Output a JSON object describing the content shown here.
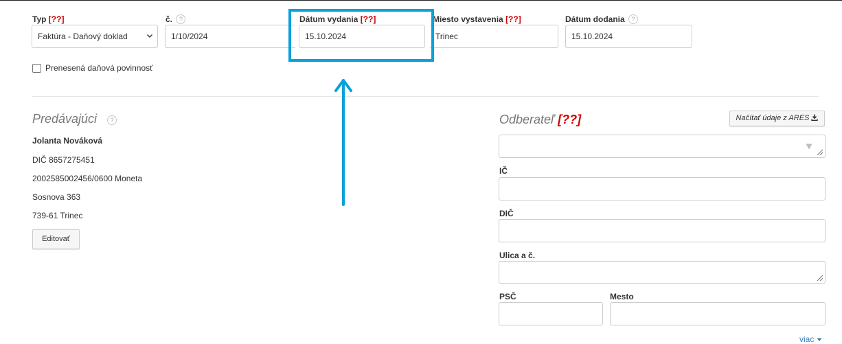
{
  "header": {
    "typ": {
      "label": "Typ",
      "required": "[??]",
      "value": "Faktúra - Daňový doklad"
    },
    "cislo": {
      "label": "č.",
      "help": "?",
      "value": "1/10/2024"
    },
    "datum_vydania": {
      "label": "Dátum vydania",
      "required": "[??]",
      "value": "15.10.2024"
    },
    "miesto": {
      "label": "Miesto vystavenia",
      "required": "[??]",
      "value": "Trinec"
    },
    "datum_dodania": {
      "label": "Dátum dodania",
      "help": "?",
      "value": "15.10.2024"
    }
  },
  "reverse_charge": {
    "label": "Prenesená daňová povinnosť",
    "checked": false
  },
  "seller": {
    "title": "Predávajúci",
    "help": "?",
    "name": "Jolanta Nováková",
    "dic": "DIČ 8657275451",
    "account": "2002585002456/0600 Moneta",
    "street": "Sosnova 363",
    "city": "739-61 Trinec",
    "edit_label": "Editovať"
  },
  "buyer": {
    "title": "Odberateľ",
    "required": "[??]",
    "ares_label": "Načítať údaje z ARES",
    "name_value": "",
    "ico_label": "IČ",
    "dic_label": "DIČ",
    "street_label": "Ulica a č.",
    "psc_label": "PSČ",
    "mesto_label": "Mesto"
  },
  "more_label": "viac",
  "annotation": {
    "color": "#0aa0dc"
  }
}
